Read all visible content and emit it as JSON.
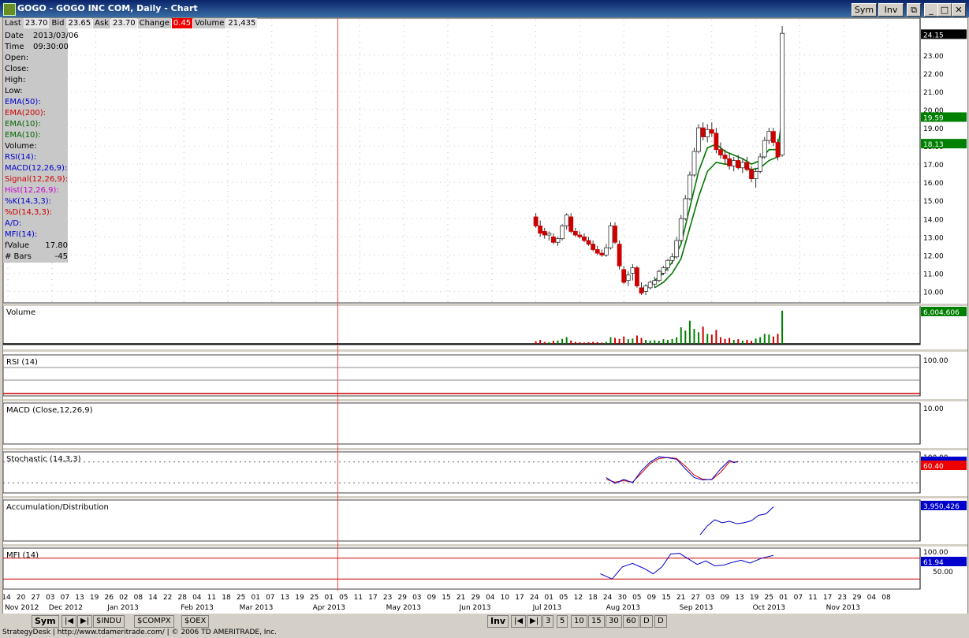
{
  "window": {
    "title": "GOGO - GOGO INC COM, Daily - Chart",
    "sym_button": "Sym",
    "inv_button": "Inv"
  },
  "quote_bar": {
    "last_label": "Last",
    "last_value": "23.70",
    "bid_label": "Bid",
    "bid_value": "23.65",
    "ask_label": "Ask",
    "ask_value": "23.70",
    "change_label": "Change",
    "change_value": "0.45",
    "volume_label": "Volume",
    "volume_value": "21,435"
  },
  "data_window": [
    {
      "label": "Date",
      "value": "2013/03/06",
      "color": "#000"
    },
    {
      "label": "Time",
      "value": "09:30:00",
      "color": "#000"
    },
    {
      "label": "Open:",
      "value": "",
      "color": "#000"
    },
    {
      "label": "Close:",
      "value": "",
      "color": "#000"
    },
    {
      "label": "High:",
      "value": "",
      "color": "#000"
    },
    {
      "label": "Low:",
      "value": "",
      "color": "#000"
    },
    {
      "label": "EMA(50):",
      "value": "",
      "color": "#0000cc"
    },
    {
      "label": "EMA(200):",
      "value": "",
      "color": "#cc0000"
    },
    {
      "label": "EMA(10):",
      "value": "",
      "color": "#006600"
    },
    {
      "label": "EMA(10):",
      "value": "",
      "color": "#006600"
    },
    {
      "label": "Volume:",
      "value": "",
      "color": "#000"
    },
    {
      "label": "RSI(14):",
      "value": "",
      "color": "#0000cc"
    },
    {
      "label": "MACD(12,26,9):",
      "value": "",
      "color": "#0000cc"
    },
    {
      "label": "Signal(12,26,9):",
      "value": "",
      "color": "#cc0000"
    },
    {
      "label": "Hist(12,26,9):",
      "value": "",
      "color": "#cc00cc"
    },
    {
      "label": "%K(14,3,3):",
      "value": "",
      "color": "#0000cc"
    },
    {
      "label": "%D(14,3,3):",
      "value": "",
      "color": "#cc0000"
    },
    {
      "label": "A/D:",
      "value": "",
      "color": "#0000cc"
    },
    {
      "label": "MFI(14):",
      "value": "",
      "color": "#0000cc"
    },
    {
      "label": "fValue",
      "value": "17.80",
      "color": "#000"
    },
    {
      "label": "# Bars",
      "value": "-45",
      "color": "#000"
    }
  ],
  "panes": {
    "volume_label": "Volume",
    "volume_last": "6,004,606",
    "rsi_label": "RSI (14)",
    "rsi_axis": "100.00",
    "macd_label": "MACD (Close,12,26,9)",
    "macd_axis": "10.00",
    "stoch_label": "Stochastic (14,3,3)",
    "stoch_axis": "100.00",
    "stoch_last": "60.40",
    "ad_label": "Accumulation/Distribution",
    "ad_last": "3,950,426",
    "mfi_label": "MFI (14)",
    "mfi_axis_top": "100.00",
    "mfi_axis_mid": "50.00",
    "mfi_last": "61.94"
  },
  "chart_data": {
    "type": "candlestick",
    "title": "GOGO - GOGO INC COM, Daily",
    "price_axis_ticks": [
      10,
      11,
      12,
      13,
      14,
      15,
      16,
      17,
      18,
      19,
      20,
      21,
      22,
      23
    ],
    "ylim": [
      9.5,
      24.6
    ],
    "last_price": "24.15",
    "ema_label_upper": "19.59",
    "ema_label_lower": "18.13",
    "x_day_labels": [
      "14",
      "20",
      "27",
      "03",
      "07",
      "13",
      "19",
      "26",
      "02",
      "08",
      "14",
      "22",
      "28",
      "04",
      "11",
      "18",
      "25",
      "01",
      "07",
      "13",
      "19",
      "25",
      "01",
      "05",
      "11",
      "17",
      "23",
      "29",
      "03",
      "09",
      "15",
      "21",
      "29",
      "04",
      "10",
      "17",
      "24",
      "01",
      "05",
      "12",
      "18",
      "24",
      "30",
      "05",
      "09",
      "15",
      "21",
      "27",
      "03",
      "09",
      "13",
      "19",
      "25",
      "01",
      "07",
      "11",
      "17",
      "23",
      "29",
      "04",
      "08"
    ],
    "x_month_labels": [
      {
        "label": "Nov 2012",
        "slot": 0
      },
      {
        "label": "Dec 2012",
        "slot": 3
      },
      {
        "label": "Jan 2013",
        "slot": 7
      },
      {
        "label": "Feb 2013",
        "slot": 12
      },
      {
        "label": "Mar 2013",
        "slot": 16
      },
      {
        "label": "Apr 2013",
        "slot": 21
      },
      {
        "label": "May 2013",
        "slot": 26
      },
      {
        "label": "Jun 2013",
        "slot": 31
      },
      {
        "label": "Jul 2013",
        "slot": 36
      },
      {
        "label": "Aug 2013",
        "slot": 41
      },
      {
        "label": "Sep 2013",
        "slot": 46
      },
      {
        "label": "Oct 2013",
        "slot": 51
      },
      {
        "label": "Nov 2013",
        "slot": 56
      }
    ],
    "cursor_slot": 22.5,
    "candles": [
      {
        "x": 36.0,
        "o": 14.1,
        "h": 14.3,
        "l": 13.5,
        "c": 13.6
      },
      {
        "x": 36.3,
        "o": 13.6,
        "h": 13.9,
        "l": 13.0,
        "c": 13.2
      },
      {
        "x": 36.6,
        "o": 13.3,
        "h": 13.5,
        "l": 12.9,
        "c": 13.1
      },
      {
        "x": 36.9,
        "o": 13.1,
        "h": 13.3,
        "l": 12.8,
        "c": 13.2
      },
      {
        "x": 37.2,
        "o": 13.0,
        "h": 13.2,
        "l": 12.6,
        "c": 12.7
      },
      {
        "x": 37.5,
        "o": 12.7,
        "h": 13.0,
        "l": 12.5,
        "c": 12.9
      },
      {
        "x": 37.8,
        "o": 12.9,
        "h": 13.7,
        "l": 12.8,
        "c": 13.6
      },
      {
        "x": 38.1,
        "o": 13.6,
        "h": 14.3,
        "l": 13.4,
        "c": 14.2
      },
      {
        "x": 38.4,
        "o": 14.1,
        "h": 14.3,
        "l": 13.2,
        "c": 13.3
      },
      {
        "x": 38.7,
        "o": 13.3,
        "h": 13.5,
        "l": 13.0,
        "c": 13.1
      },
      {
        "x": 39.0,
        "o": 13.1,
        "h": 13.3,
        "l": 12.9,
        "c": 13.0
      },
      {
        "x": 39.3,
        "o": 13.0,
        "h": 13.2,
        "l": 12.7,
        "c": 12.8
      },
      {
        "x": 39.6,
        "o": 12.8,
        "h": 13.0,
        "l": 12.5,
        "c": 12.6
      },
      {
        "x": 39.9,
        "o": 12.6,
        "h": 12.8,
        "l": 12.2,
        "c": 12.3
      },
      {
        "x": 40.2,
        "o": 12.3,
        "h": 12.5,
        "l": 12.0,
        "c": 12.1
      },
      {
        "x": 40.5,
        "o": 12.1,
        "h": 12.3,
        "l": 11.9,
        "c": 12.0
      },
      {
        "x": 40.8,
        "o": 12.0,
        "h": 12.6,
        "l": 11.9,
        "c": 12.4
      },
      {
        "x": 41.1,
        "o": 12.4,
        "h": 13.8,
        "l": 12.3,
        "c": 13.6
      },
      {
        "x": 41.4,
        "o": 13.6,
        "h": 13.8,
        "l": 12.6,
        "c": 12.7
      },
      {
        "x": 41.7,
        "o": 12.6,
        "h": 12.8,
        "l": 11.2,
        "c": 11.4
      },
      {
        "x": 42.0,
        "o": 11.2,
        "h": 11.4,
        "l": 10.4,
        "c": 10.5
      },
      {
        "x": 42.3,
        "o": 10.6,
        "h": 11.1,
        "l": 10.3,
        "c": 10.9
      },
      {
        "x": 42.6,
        "o": 11.0,
        "h": 11.5,
        "l": 10.6,
        "c": 11.3
      },
      {
        "x": 42.9,
        "o": 11.3,
        "h": 11.4,
        "l": 10.2,
        "c": 10.3
      },
      {
        "x": 43.2,
        "o": 10.2,
        "h": 10.5,
        "l": 9.8,
        "c": 9.9
      },
      {
        "x": 43.5,
        "o": 10.0,
        "h": 10.4,
        "l": 9.8,
        "c": 10.3
      },
      {
        "x": 43.8,
        "o": 10.2,
        "h": 10.6,
        "l": 10.1,
        "c": 10.5
      },
      {
        "x": 44.1,
        "o": 10.4,
        "h": 10.8,
        "l": 10.2,
        "c": 10.6
      },
      {
        "x": 44.4,
        "o": 10.6,
        "h": 11.2,
        "l": 10.5,
        "c": 11.1
      },
      {
        "x": 44.7,
        "o": 11.0,
        "h": 11.4,
        "l": 10.9,
        "c": 11.3
      },
      {
        "x": 45.0,
        "o": 11.3,
        "h": 11.8,
        "l": 11.1,
        "c": 11.7
      },
      {
        "x": 45.3,
        "o": 11.7,
        "h": 12.1,
        "l": 11.5,
        "c": 11.9
      },
      {
        "x": 45.6,
        "o": 11.9,
        "h": 13.0,
        "l": 11.8,
        "c": 12.8
      },
      {
        "x": 45.9,
        "o": 12.8,
        "h": 14.2,
        "l": 12.7,
        "c": 14.0
      },
      {
        "x": 46.2,
        "o": 14.0,
        "h": 15.3,
        "l": 13.9,
        "c": 15.1
      },
      {
        "x": 46.5,
        "o": 15.1,
        "h": 16.6,
        "l": 15.0,
        "c": 16.4
      },
      {
        "x": 46.8,
        "o": 16.4,
        "h": 17.9,
        "l": 16.3,
        "c": 17.7
      },
      {
        "x": 47.1,
        "o": 17.7,
        "h": 19.2,
        "l": 17.6,
        "c": 19.0
      },
      {
        "x": 47.4,
        "o": 19.0,
        "h": 19.3,
        "l": 18.3,
        "c": 18.5
      },
      {
        "x": 47.7,
        "o": 18.5,
        "h": 19.2,
        "l": 18.2,
        "c": 18.9
      },
      {
        "x": 48.0,
        "o": 18.9,
        "h": 19.3,
        "l": 18.5,
        "c": 18.7
      },
      {
        "x": 48.3,
        "o": 18.7,
        "h": 19.0,
        "l": 17.6,
        "c": 17.8
      },
      {
        "x": 48.6,
        "o": 17.8,
        "h": 18.2,
        "l": 17.3,
        "c": 17.5
      },
      {
        "x": 48.9,
        "o": 17.5,
        "h": 17.8,
        "l": 17.0,
        "c": 17.3
      },
      {
        "x": 49.2,
        "o": 17.3,
        "h": 17.6,
        "l": 16.7,
        "c": 16.9
      },
      {
        "x": 49.5,
        "o": 16.9,
        "h": 17.4,
        "l": 16.6,
        "c": 17.2
      },
      {
        "x": 49.8,
        "o": 17.2,
        "h": 17.5,
        "l": 16.7,
        "c": 16.8
      },
      {
        "x": 50.1,
        "o": 16.8,
        "h": 17.3,
        "l": 16.5,
        "c": 17.1
      },
      {
        "x": 50.4,
        "o": 17.1,
        "h": 17.4,
        "l": 16.6,
        "c": 16.7
      },
      {
        "x": 50.7,
        "o": 16.7,
        "h": 16.9,
        "l": 16.0,
        "c": 16.2
      },
      {
        "x": 51.0,
        "o": 16.2,
        "h": 16.8,
        "l": 15.7,
        "c": 16.6
      },
      {
        "x": 51.3,
        "o": 16.6,
        "h": 17.6,
        "l": 16.5,
        "c": 17.4
      },
      {
        "x": 51.6,
        "o": 17.4,
        "h": 18.5,
        "l": 17.3,
        "c": 18.3
      },
      {
        "x": 51.9,
        "o": 18.3,
        "h": 19.0,
        "l": 18.1,
        "c": 18.8
      },
      {
        "x": 52.2,
        "o": 18.8,
        "h": 19.0,
        "l": 18.0,
        "c": 18.2
      },
      {
        "x": 52.5,
        "o": 18.2,
        "h": 18.4,
        "l": 17.2,
        "c": 17.4
      },
      {
        "x": 52.8,
        "o": 17.5,
        "h": 24.6,
        "l": 17.4,
        "c": 24.2
      }
    ],
    "ema_fast": [
      [
        44.1,
        10.6
      ],
      [
        44.7,
        11.0
      ],
      [
        45.3,
        11.6
      ],
      [
        45.9,
        12.6
      ],
      [
        46.5,
        14.6
      ],
      [
        47.1,
        16.6
      ],
      [
        47.7,
        17.9
      ],
      [
        48.3,
        18.1
      ],
      [
        48.9,
        17.7
      ],
      [
        49.5,
        17.5
      ],
      [
        50.1,
        17.3
      ],
      [
        50.7,
        17.0
      ],
      [
        51.3,
        17.2
      ],
      [
        51.9,
        17.8
      ],
      [
        52.5,
        17.8
      ],
      [
        52.8,
        19.6
      ]
    ],
    "ema_slow": [
      [
        44.1,
        10.2
      ],
      [
        44.7,
        10.5
      ],
      [
        45.3,
        11.0
      ],
      [
        45.9,
        11.8
      ],
      [
        46.5,
        13.5
      ],
      [
        47.1,
        15.2
      ],
      [
        47.7,
        16.6
      ],
      [
        48.3,
        17.1
      ],
      [
        48.9,
        17.0
      ],
      [
        49.5,
        17.0
      ],
      [
        50.1,
        16.9
      ],
      [
        50.7,
        16.7
      ],
      [
        51.3,
        16.8
      ],
      [
        51.9,
        17.2
      ],
      [
        52.5,
        17.4
      ],
      [
        52.8,
        18.1
      ]
    ],
    "volume_bars": [
      0.08,
      0.12,
      0.06,
      0.05,
      0.09,
      0.1,
      0.15,
      0.2,
      0.1,
      0.06,
      0.05,
      0.04,
      0.05,
      0.06,
      0.05,
      0.04,
      0.06,
      0.2,
      0.18,
      0.15,
      0.22,
      0.14,
      0.16,
      0.25,
      0.18,
      0.12,
      0.1,
      0.11,
      0.09,
      0.14,
      0.12,
      0.15,
      0.2,
      0.5,
      0.4,
      0.7,
      0.45,
      0.35,
      0.52,
      0.3,
      0.28,
      0.42,
      0.2,
      0.15,
      0.18,
      0.12,
      0.14,
      0.1,
      0.12,
      0.09,
      0.16,
      0.2,
      0.3,
      0.28,
      0.22,
      0.3,
      1.0
    ],
    "stoch_k": [
      [
        46.0,
        35
      ],
      [
        46.6,
        18
      ],
      [
        47.2,
        30
      ],
      [
        47.8,
        20
      ],
      [
        48.4,
        55
      ],
      [
        49.0,
        80
      ],
      [
        49.6,
        95
      ],
      [
        50.2,
        92
      ],
      [
        50.8,
        88
      ],
      [
        51.4,
        60
      ],
      [
        52.0,
        35
      ],
      [
        52.6,
        28
      ],
      [
        53.2,
        30
      ],
      [
        53.8,
        60
      ],
      [
        54.4,
        85
      ],
      [
        54.7,
        78
      ],
      [
        55.0,
        82
      ]
    ],
    "stoch_d": [
      [
        46.0,
        30
      ],
      [
        46.6,
        22
      ],
      [
        47.2,
        26
      ],
      [
        47.8,
        22
      ],
      [
        48.4,
        48
      ],
      [
        49.0,
        75
      ],
      [
        49.6,
        90
      ],
      [
        50.2,
        93
      ],
      [
        50.8,
        90
      ],
      [
        51.4,
        68
      ],
      [
        52.0,
        42
      ],
      [
        52.6,
        30
      ],
      [
        53.2,
        29
      ],
      [
        53.8,
        50
      ],
      [
        54.4,
        80
      ],
      [
        54.7,
        80
      ],
      [
        55.0,
        80
      ]
    ],
    "ad_line": [
      [
        50.0,
        0.05
      ],
      [
        50.5,
        0.35
      ],
      [
        51.0,
        0.55
      ],
      [
        51.5,
        0.45
      ],
      [
        52.0,
        0.5
      ],
      [
        52.5,
        0.42
      ],
      [
        53.0,
        0.45
      ],
      [
        53.5,
        0.52
      ],
      [
        54.0,
        0.7
      ],
      [
        54.5,
        0.75
      ],
      [
        55.0,
        0.98
      ]
    ],
    "mfi_line": [
      [
        41.0,
        35
      ],
      [
        41.8,
        20
      ],
      [
        42.5,
        55
      ],
      [
        43.2,
        65
      ],
      [
        44.0,
        50
      ],
      [
        44.6,
        35
      ],
      [
        45.2,
        55
      ],
      [
        45.8,
        92
      ],
      [
        46.4,
        94
      ],
      [
        47.0,
        78
      ],
      [
        47.6,
        62
      ],
      [
        48.2,
        72
      ],
      [
        48.8,
        58
      ],
      [
        49.4,
        60
      ],
      [
        50.0,
        68
      ],
      [
        50.6,
        74
      ],
      [
        51.2,
        66
      ],
      [
        52.0,
        80
      ],
      [
        52.8,
        88
      ]
    ]
  },
  "tabbar": {
    "sym": "Sym",
    "tabs": [
      "$INDU",
      "$COMPX",
      "$OEX"
    ],
    "inv": "Inv",
    "intervals": [
      "3",
      "5",
      "10",
      "15",
      "30",
      "60",
      "D",
      "D"
    ]
  },
  "statusbar": {
    "text": "StrategyDesk | http://www.tdameritrade.com/ | © 2006 TD AMERITRADE, Inc."
  }
}
